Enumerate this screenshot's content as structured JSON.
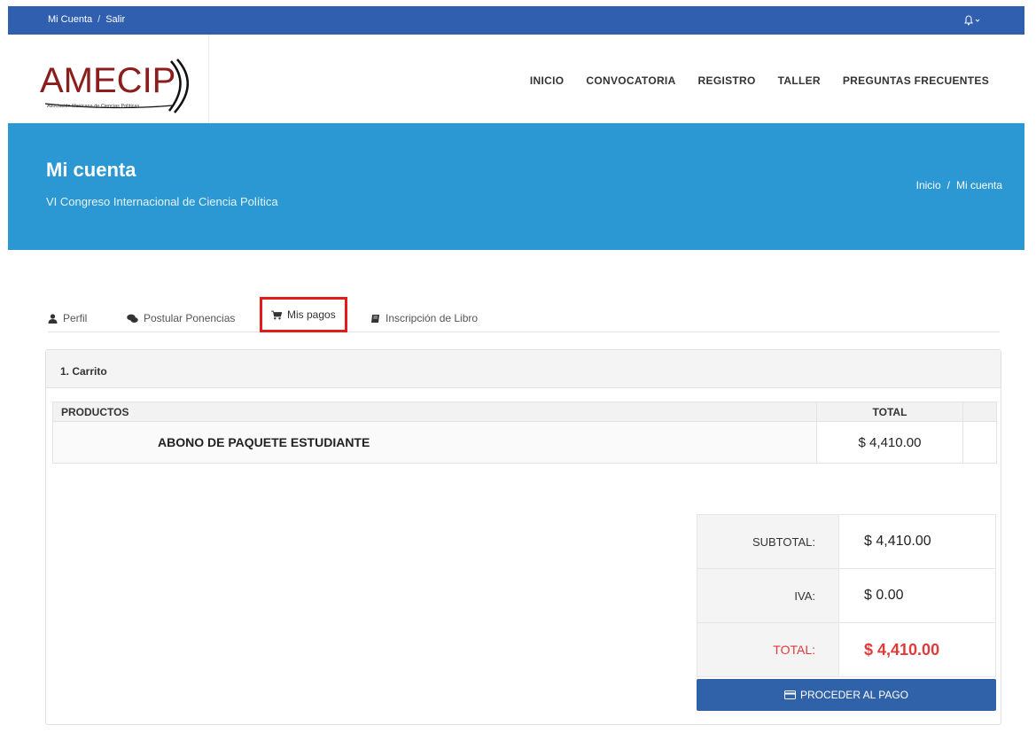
{
  "topbar": {
    "account_link": "Mi Cuenta",
    "separator": "/",
    "logout_link": "Salir"
  },
  "logo": {
    "word": "AMECIP",
    "tagline": "Asociación Mexicana de Ciencias Políticas"
  },
  "nav": {
    "items": [
      {
        "label": "INICIO"
      },
      {
        "label": "CONVOCATORIA"
      },
      {
        "label": "REGISTRO"
      },
      {
        "label": "TALLER"
      },
      {
        "label": "PREGUNTAS FRECUENTES"
      }
    ]
  },
  "hero": {
    "title": "Mi cuenta",
    "subtitle": "VI Congreso Internacional de Ciencia Política",
    "breadcrumb_home": "Inicio",
    "breadcrumb_sep": "/",
    "breadcrumb_current": "Mi cuenta"
  },
  "tabs": [
    {
      "label": "Perfil",
      "icon": "user-icon"
    },
    {
      "label": "Postular Ponencias",
      "icon": "comments-icon"
    },
    {
      "label": "Mis pagos",
      "icon": "cart-icon",
      "active": true
    },
    {
      "label": "Inscripción de Libro",
      "icon": "book-icon"
    }
  ],
  "cart": {
    "step_title": "1. Carrito",
    "col_products": "PRODUCTOS",
    "col_total": "TOTAL",
    "items": [
      {
        "name": "ABONO DE PAQUETE ESTUDIANTE",
        "amount": "$ 4,410.00"
      }
    ],
    "subtotal_label": "SUBTOTAL:",
    "subtotal_value": "$ 4,410.00",
    "tax_label": "IVA:",
    "tax_value": "$ 0.00",
    "total_label": "TOTAL:",
    "total_value": "$ 4,410.00",
    "pay_button": "PROCEDER AL PAGO"
  },
  "colors": {
    "topbar": "#2f5fae",
    "hero": "#2b98d3",
    "brand_red": "#8c1d1d",
    "total_red": "#e03a3a",
    "button_blue": "#2f62a8",
    "highlight": "#e21b1b"
  }
}
